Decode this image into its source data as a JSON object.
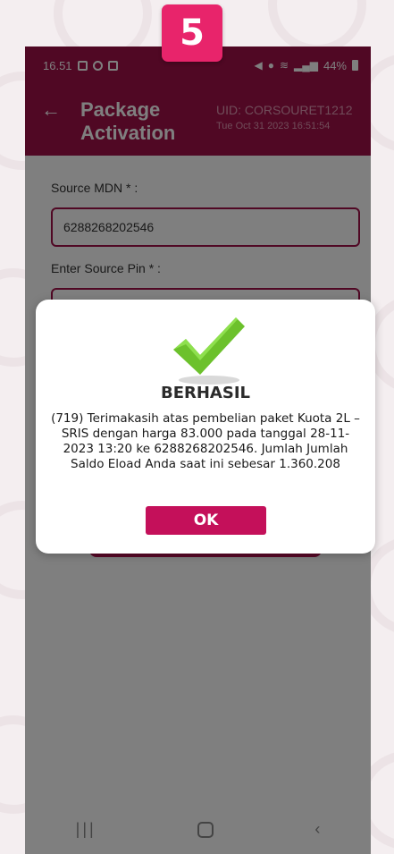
{
  "step_badge": "5",
  "status_bar": {
    "time": "16.51",
    "signal_text": "4G",
    "battery": "44%"
  },
  "app_bar": {
    "title": "Package Activation",
    "uid": "UID: CORSOURET1212",
    "datetime": "Tue Oct 31 2023 16:51:54"
  },
  "form": {
    "source_mdn_label": "Source MDN * :",
    "source_mdn_value": "6288268202546",
    "source_pin_label": "Enter Source Pin * :"
  },
  "dialog": {
    "title": "BERHASIL",
    "message": "(719) Terimakasih atas pembelian paket Kuota 2L – SRIS dengan harga 83.000 pada tanggal 28-11-2023 13:20 ke 6288268202546. Jumlah Jumlah Saldo Eload Anda saat ini sebesar 1.360.208",
    "ok_label": "OK"
  },
  "colors": {
    "brand": "#a01048",
    "badge": "#e8246b",
    "ok_button": "#c4105a",
    "check": "#6cc12c"
  }
}
